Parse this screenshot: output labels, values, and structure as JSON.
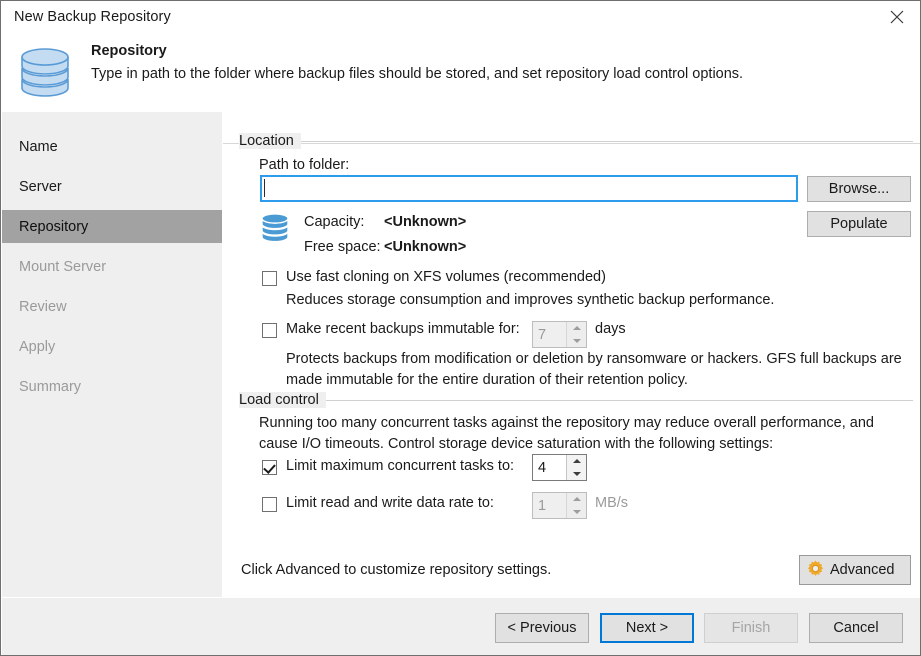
{
  "window": {
    "title": "New Backup Repository",
    "close_icon": "close-icon"
  },
  "header": {
    "icon": "repository-database-icon",
    "title": "Repository",
    "description": "Type in path to the folder where backup files should be stored, and set repository load control options."
  },
  "sidebar": {
    "items": [
      {
        "label": "Name",
        "state": "done"
      },
      {
        "label": "Server",
        "state": "done"
      },
      {
        "label": "Repository",
        "state": "active"
      },
      {
        "label": "Mount Server",
        "state": "pending"
      },
      {
        "label": "Review",
        "state": "pending"
      },
      {
        "label": "Apply",
        "state": "pending"
      },
      {
        "label": "Summary",
        "state": "pending"
      }
    ]
  },
  "location": {
    "group_label": "Location",
    "path_label": "Path to folder:",
    "path_value": "",
    "path_placeholder": "",
    "browse_label": "Browse...",
    "populate_label": "Populate",
    "storage_icon": "database-icon",
    "capacity_label": "Capacity:",
    "capacity_value": "<Unknown>",
    "free_space_label": "Free space:",
    "free_space_value": "<Unknown>",
    "fast_clone": {
      "label": "Use fast cloning on XFS volumes (recommended)",
      "checked": false,
      "hint": "Reduces storage consumption and improves synthetic backup performance."
    },
    "immutable": {
      "label": "Make recent backups immutable for:",
      "checked": false,
      "value": "7",
      "unit": "days",
      "enabled": false,
      "hint_line1": "Protects backups from modification or deletion by ransomware or hackers. GFS full backups are",
      "hint_line2": "made immutable for the entire duration of their retention policy."
    }
  },
  "load_control": {
    "group_label": "Load control",
    "hint_line1": "Running too many concurrent tasks against the repository may reduce overall performance, and",
    "hint_line2": "cause I/O timeouts. Control storage device saturation with the following settings:",
    "limit_tasks": {
      "label": "Limit maximum concurrent tasks to:",
      "checked": true,
      "value": "4",
      "enabled": true
    },
    "limit_rate": {
      "label": "Limit read and write data rate to:",
      "checked": false,
      "value": "1",
      "unit": "MB/s",
      "enabled": false
    }
  },
  "advanced": {
    "hint": "Click Advanced to customize repository settings.",
    "button_label": "Advanced",
    "gear_icon": "gear-icon",
    "gear_color": "#f0a828"
  },
  "footer": {
    "previous_label": "< Previous",
    "next_label": "Next >",
    "finish_label": "Finish",
    "cancel_label": "Cancel",
    "finish_enabled": false,
    "next_focused": true
  },
  "colors": {
    "accent": "#0078d7",
    "field_focus": "#2d9ced",
    "panel": "#efefef",
    "nav_active": "#a2a2a2",
    "gear": "#f0a828"
  }
}
